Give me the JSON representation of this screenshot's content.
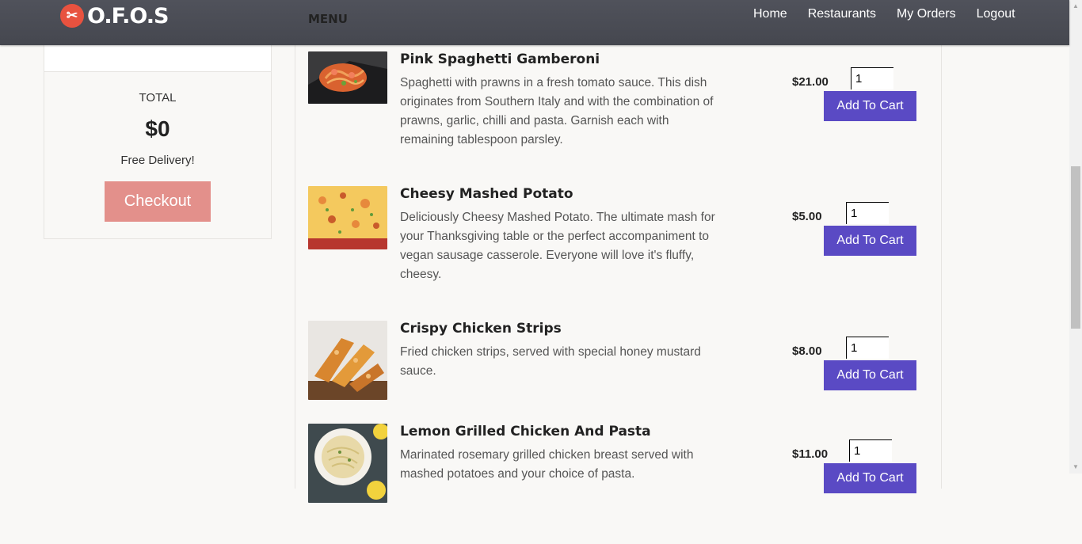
{
  "navbar": {
    "logo_text": "O.F.O.S",
    "menu_label": "MENU",
    "links": [
      "Home",
      "Restaurants",
      "My Orders",
      "Logout"
    ]
  },
  "cart": {
    "total_label": "TOTAL",
    "total_amount": "$0",
    "delivery_note": "Free Delivery!",
    "checkout_label": "Checkout"
  },
  "menu": {
    "items": [
      {
        "title": "Pink Spaghetti Gamberoni",
        "description": "Spaghetti with prawns in a fresh tomato sauce. This dish originates from Southern Italy and with the combination of prawns, garlic, chilli and pasta. Garnish each with remaining tablespoon parsley.",
        "price": "$21.00",
        "quantity": "1",
        "button_label": "Add To Cart"
      },
      {
        "title": "Cheesy Mashed Potato",
        "description": "Deliciously Cheesy Mashed Potato. The ultimate mash for your Thanksgiving table or the perfect accompaniment to vegan sausage casserole. Everyone will love it's fluffy, cheesy.",
        "price": "$5.00",
        "quantity": "1",
        "button_label": "Add To Cart"
      },
      {
        "title": "Crispy Chicken Strips",
        "description": "Fried chicken strips, served with special honey mustard sauce.",
        "price": "$8.00",
        "quantity": "1",
        "button_label": "Add To Cart"
      },
      {
        "title": "Lemon Grilled Chicken And Pasta",
        "description": "Marinated rosemary grilled chicken breast served with mashed potatoes and your choice of pasta.",
        "price": "$11.00",
        "quantity": "1",
        "button_label": "Add To Cart"
      }
    ]
  },
  "colors": {
    "navbar_bg": "#4a4c55",
    "brand_red": "#e8523f",
    "checkout_bg": "#e3908b",
    "add_to_cart_bg": "#5a4ac4"
  }
}
